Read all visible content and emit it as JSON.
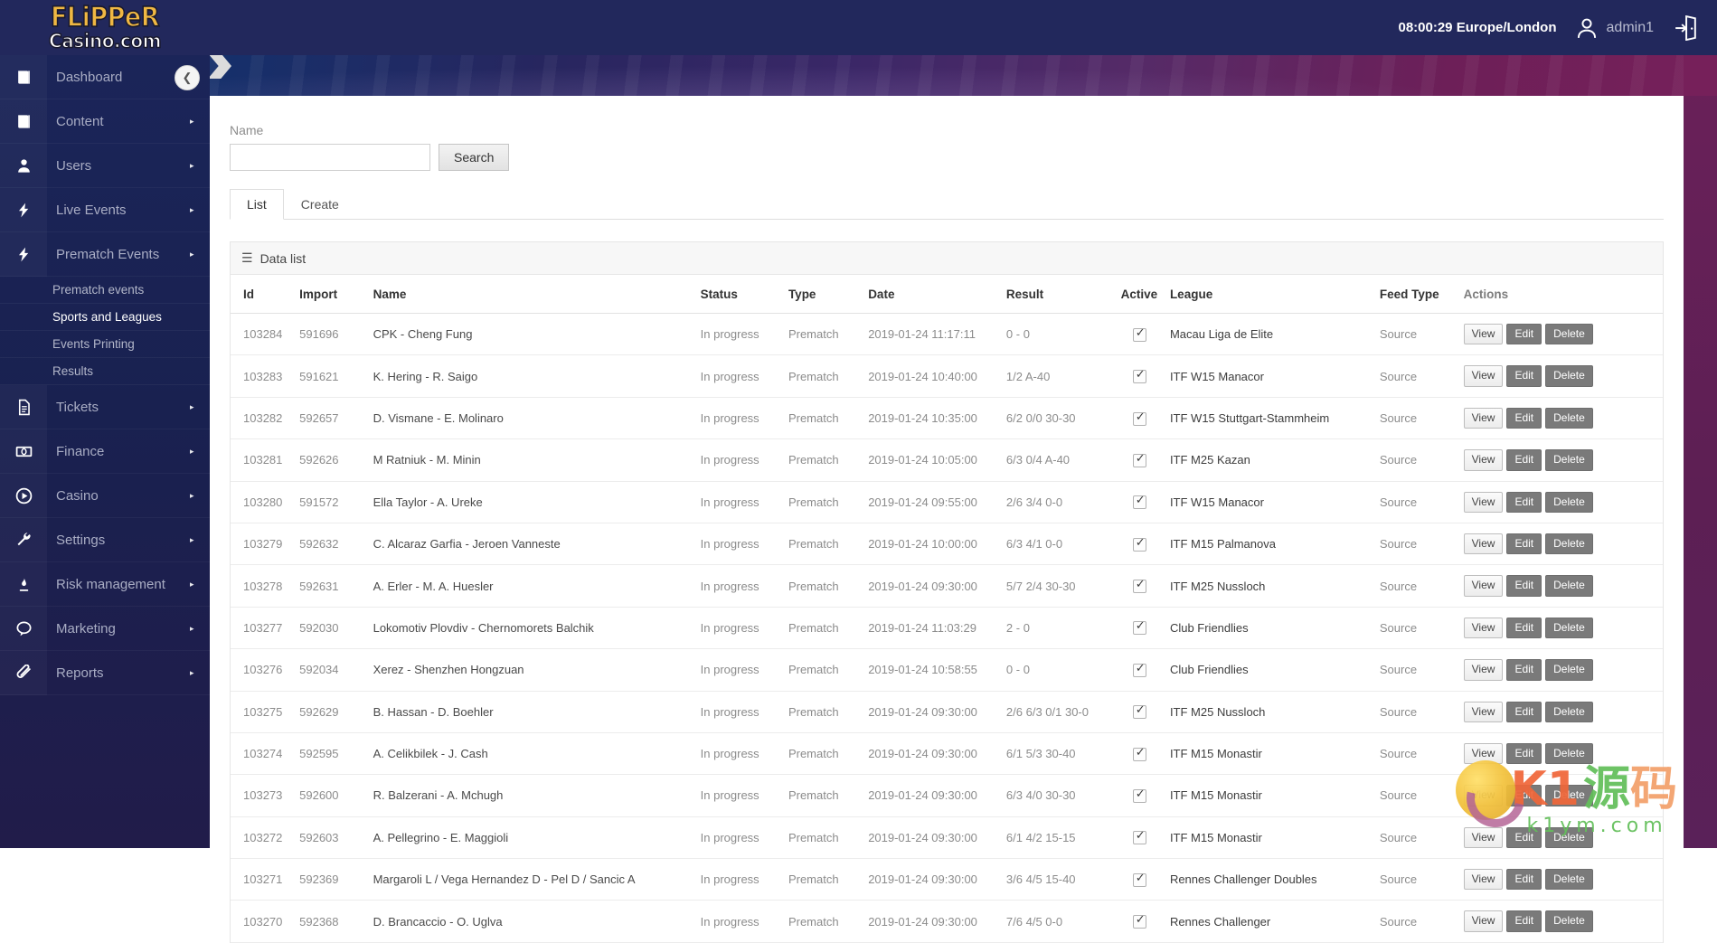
{
  "brand": {
    "line1": "FLiPPeR",
    "line2": "Casino.com"
  },
  "header": {
    "clock": "08:00:29 Europe/London",
    "username": "admin1",
    "avatar_icon": "user-avatar-icon",
    "logout_icon": "logout-door-icon"
  },
  "sidebar": {
    "collapse_icon": "chevron-left-icon",
    "items": [
      {
        "label": "Dashboard",
        "icon": "book-icon",
        "caret": "▸"
      },
      {
        "label": "Content",
        "icon": "book-icon",
        "caret": "▸"
      },
      {
        "label": "Users",
        "icon": "user-icon",
        "caret": "▸"
      },
      {
        "label": "Live Events",
        "icon": "bolt-icon",
        "caret": "▸"
      },
      {
        "label": "Prematch Events",
        "icon": "bolt-icon",
        "caret": "▸"
      },
      {
        "label": "Tickets",
        "icon": "document-icon",
        "caret": "▸"
      },
      {
        "label": "Finance",
        "icon": "banknote-icon",
        "caret": "▸"
      },
      {
        "label": "Casino",
        "icon": "play-circle-icon",
        "caret": "▸"
      },
      {
        "label": "Settings",
        "icon": "wrench-icon",
        "caret": "▸"
      },
      {
        "label": "Risk management",
        "icon": "flame-icon",
        "caret": "▸"
      },
      {
        "label": "Marketing",
        "icon": "chat-icon",
        "caret": "▸"
      },
      {
        "label": "Reports",
        "icon": "paperclip-icon",
        "caret": "▸"
      }
    ],
    "subitems": [
      {
        "label": "Prematch events",
        "active": false
      },
      {
        "label": "Sports and Leagues",
        "active": true
      },
      {
        "label": "Events Printing",
        "active": false
      },
      {
        "label": "Results",
        "active": false
      }
    ]
  },
  "breadcrumb": {
    "home_icon": "home-icon",
    "arrow_icon": "chevron-right-icon"
  },
  "search": {
    "label": "Name",
    "value": "",
    "placeholder": "",
    "button": "Search"
  },
  "tabs": [
    {
      "label": "List",
      "active": true
    },
    {
      "label": "Create",
      "active": false
    }
  ],
  "panel": {
    "icon": "hamburger-icon",
    "title": "Data list"
  },
  "table": {
    "headers": [
      "Id",
      "Import",
      "Name",
      "Status",
      "Type",
      "Date",
      "Result",
      "Active",
      "League",
      "Feed Type",
      "Actions"
    ],
    "actions": {
      "view": "View",
      "edit": "Edit",
      "delete": "Delete"
    },
    "rows": [
      {
        "id": "103284",
        "import": "591696",
        "name": "CPK - Cheng Fung",
        "status": "In progress",
        "type": "Prematch",
        "date": "2019-01-24 11:17:11",
        "result": "0 - 0",
        "active": true,
        "league": "Macau Liga de Elite",
        "feed": "Source"
      },
      {
        "id": "103283",
        "import": "591621",
        "name": "K. Hering - R. Saigo",
        "status": "In progress",
        "type": "Prematch",
        "date": "2019-01-24 10:40:00",
        "result": "1/2 A-40",
        "active": true,
        "league": "ITF W15 Manacor",
        "feed": "Source"
      },
      {
        "id": "103282",
        "import": "592657",
        "name": "D. Vismane - E. Molinaro",
        "status": "In progress",
        "type": "Prematch",
        "date": "2019-01-24 10:35:00",
        "result": "6/2 0/0 30-30",
        "active": true,
        "league": "ITF W15 Stuttgart-Stammheim",
        "feed": "Source"
      },
      {
        "id": "103281",
        "import": "592626",
        "name": "M Ratniuk - M. Minin",
        "status": "In progress",
        "type": "Prematch",
        "date": "2019-01-24 10:05:00",
        "result": "6/3 0/4 A-40",
        "active": true,
        "league": "ITF M25 Kazan",
        "feed": "Source"
      },
      {
        "id": "103280",
        "import": "591572",
        "name": "Ella Taylor - A. Ureke",
        "status": "In progress",
        "type": "Prematch",
        "date": "2019-01-24 09:55:00",
        "result": "2/6 3/4 0-0",
        "active": true,
        "league": "ITF W15 Manacor",
        "feed": "Source"
      },
      {
        "id": "103279",
        "import": "592632",
        "name": "C. Alcaraz Garfia - Jeroen Vanneste",
        "status": "In progress",
        "type": "Prematch",
        "date": "2019-01-24 10:00:00",
        "result": "6/3 4/1 0-0",
        "active": true,
        "league": "ITF M15 Palmanova",
        "feed": "Source"
      },
      {
        "id": "103278",
        "import": "592631",
        "name": "A. Erler - M. A. Huesler",
        "status": "In progress",
        "type": "Prematch",
        "date": "2019-01-24 09:30:00",
        "result": "5/7 2/4 30-30",
        "active": true,
        "league": "ITF M25 Nussloch",
        "feed": "Source"
      },
      {
        "id": "103277",
        "import": "592030",
        "name": "Lokomotiv Plovdiv - Chernomorets Balchik",
        "status": "In progress",
        "type": "Prematch",
        "date": "2019-01-24 11:03:29",
        "result": "2 - 0",
        "active": true,
        "league": "Club Friendlies",
        "feed": "Source"
      },
      {
        "id": "103276",
        "import": "592034",
        "name": "Xerez - Shenzhen Hongzuan",
        "status": "In progress",
        "type": "Prematch",
        "date": "2019-01-24 10:58:55",
        "result": "0 - 0",
        "active": true,
        "league": "Club Friendlies",
        "feed": "Source"
      },
      {
        "id": "103275",
        "import": "592629",
        "name": "B. Hassan - D. Boehler",
        "status": "In progress",
        "type": "Prematch",
        "date": "2019-01-24 09:30:00",
        "result": "2/6 6/3 0/1 30-0",
        "active": true,
        "league": "ITF M25 Nussloch",
        "feed": "Source"
      },
      {
        "id": "103274",
        "import": "592595",
        "name": "A. Celikbilek - J. Cash",
        "status": "In progress",
        "type": "Prematch",
        "date": "2019-01-24 09:30:00",
        "result": "6/1 5/3 30-40",
        "active": true,
        "league": "ITF M15 Monastir",
        "feed": "Source"
      },
      {
        "id": "103273",
        "import": "592600",
        "name": "R. Balzerani - A. Mchugh",
        "status": "In progress",
        "type": "Prematch",
        "date": "2019-01-24 09:30:00",
        "result": "6/3 4/0 30-30",
        "active": true,
        "league": "ITF M15 Monastir",
        "feed": "Source"
      },
      {
        "id": "103272",
        "import": "592603",
        "name": "A. Pellegrino - E. Maggioli",
        "status": "In progress",
        "type": "Prematch",
        "date": "2019-01-24 09:30:00",
        "result": "6/1 4/2 15-15",
        "active": true,
        "league": "ITF M15 Monastir",
        "feed": "Source"
      },
      {
        "id": "103271",
        "import": "592369",
        "name": "Margaroli L / Vega Hernandez D - Pel D / Sancic A",
        "status": "In progress",
        "type": "Prematch",
        "date": "2019-01-24 09:30:00",
        "result": "3/6 4/5 15-40",
        "active": true,
        "league": "Rennes Challenger Doubles",
        "feed": "Source"
      },
      {
        "id": "103270",
        "import": "592368",
        "name": "D. Brancaccio - O. Uglva",
        "status": "In progress",
        "type": "Prematch",
        "date": "2019-01-24 09:30:00",
        "result": "7/6 4/5 0-0",
        "active": true,
        "league": "Rennes Challenger",
        "feed": "Source"
      }
    ]
  },
  "watermark": {
    "k1": "K1",
    "cn_green": "源",
    "cn_orange": "码",
    "domain": "k1ym.com"
  },
  "colors": {
    "topbar": "#22285c",
    "sidebar": "#1b2559",
    "banner_start": "#15306b",
    "banner_end": "#76205a",
    "accent_gold": "#f0b843",
    "rail_purple": "#5d1f54"
  }
}
